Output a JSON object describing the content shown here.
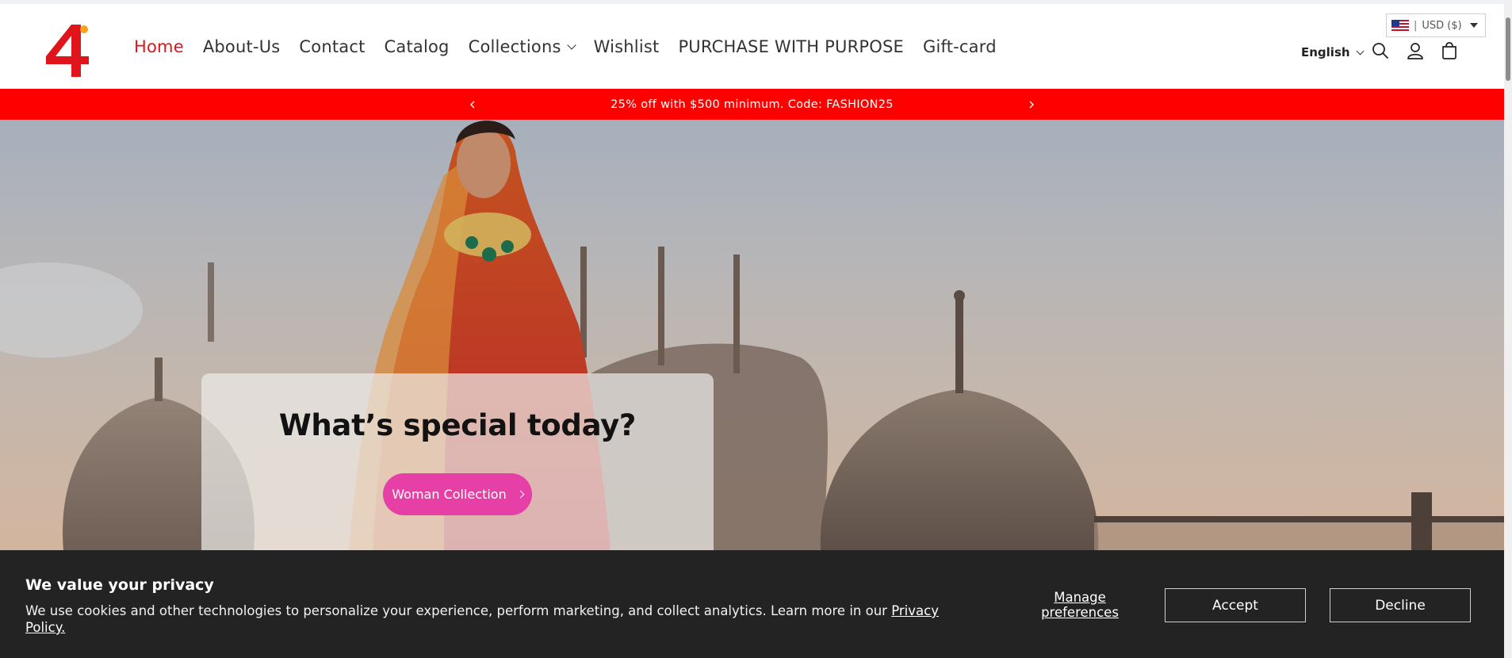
{
  "brand": {
    "logo_text": "4",
    "accent": "#e0141b"
  },
  "nav": {
    "items": [
      {
        "label": "Home",
        "active": true
      },
      {
        "label": "About-Us"
      },
      {
        "label": "Contact"
      },
      {
        "label": "Catalog"
      },
      {
        "label": "Collections",
        "has_dropdown": true
      },
      {
        "label": "Wishlist"
      },
      {
        "label": "PURCHASE WITH PURPOSE"
      },
      {
        "label": "Gift-card"
      }
    ]
  },
  "header": {
    "currency": {
      "separator": "|",
      "selected": "USD ($)",
      "flag_icon": "us-flag-icon"
    },
    "language": "English",
    "icons": [
      "search-icon",
      "account-icon",
      "cart-icon"
    ]
  },
  "announcement": {
    "text": "25% off with $500 minimum. Code: FASHION25",
    "background": "#ff0000"
  },
  "hero": {
    "title": "What’s special today?",
    "button_label": "Woman Collection",
    "button_color": "#e63fa6"
  },
  "cookie": {
    "title": "We value your privacy",
    "text": "We use cookies and other technologies to personalize your experience, perform marketing, and collect analytics. Learn more in our",
    "link": "Privacy Policy.",
    "manage": "Manage preferences",
    "accept": "Accept",
    "decline": "Decline"
  }
}
